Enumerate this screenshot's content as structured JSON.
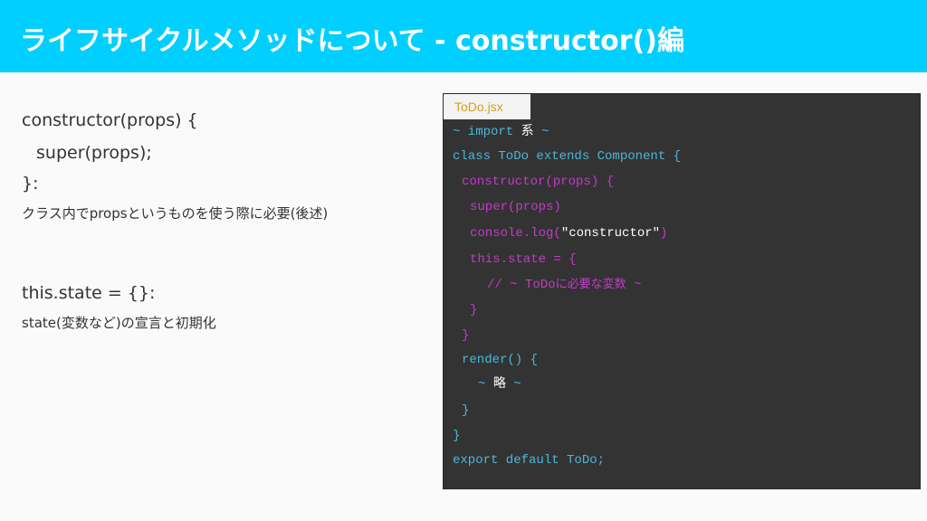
{
  "slide": {
    "title": "ライフサイクルメソッドについて - constructor()編",
    "colors": {
      "header": "#00cfff",
      "panel": "#333333",
      "keyword_blue": "#4bb8d8",
      "code_purple": "#c23cc8",
      "tab_text": "#d4a21a"
    }
  },
  "notes": {
    "line1": "constructor(props) {",
    "line2": "super(props);",
    "line3": "}:",
    "desc1": "クラス内でpropsというものを使う際に必要(後述)",
    "line4": "this.state = {}:",
    "desc2": "state(変数など)の宣言と初期化"
  },
  "code_panel": {
    "tab": "ToDo.jsx",
    "l1a": "~ import ",
    "l1b": "系",
    "l1c": " ~",
    "l2": "class ToDo extends Component {",
    "l3": "constructor(props) {",
    "l4": "super(props)",
    "l5a": "console.log(",
    "l5b": "\"constructor\"",
    "l5c": ")",
    "l6": "this.state = {",
    "l7a": "// ~ ToDo",
    "l7b": "に必要な変数",
    "l7c": " ~",
    "l8": "}",
    "l9": "}",
    "l10": "render() {",
    "l11a": "~ ",
    "l11b": "略",
    "l11c": " ~",
    "l12": "}",
    "l13": "}",
    "l14": "export default ToDo;"
  }
}
